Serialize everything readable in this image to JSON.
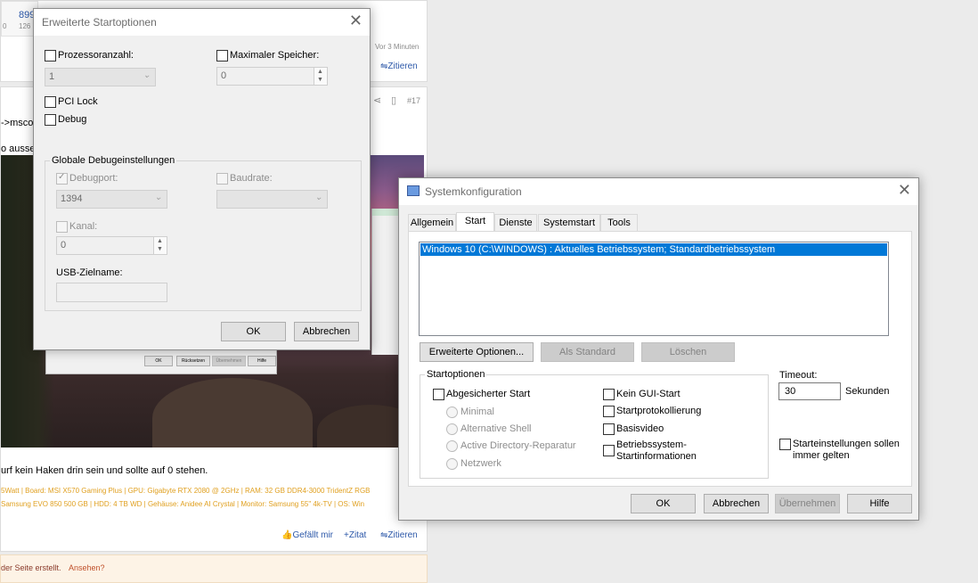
{
  "forum": {
    "post_top": {
      "number": "899",
      "sub": "126",
      "zero": "0",
      "time": "Vor 3 Minuten",
      "quote": "Zitieren"
    },
    "post_mid": {
      "number": "#17",
      "text_mscor": "->mscor",
      "text_aussehen": "o ausseh"
    },
    "post_text": "urf kein Haken drin sein und sollte auf 0 stehen.",
    "sig_line1": "5Watt | Board: MSI X570 Gaming Plus | GPU: Gigabyte RTX 2080 @ 2GHz | RAM: 32 GB DDR4-3000 TridentZ RGB",
    "sig_line2": "Samsung EVO 850 500 GB | HDD: 4 TB WD | Gehäuse: Anidee AI Crystal | Monitor: Samsung 55\" 4k-TV | OS: Win",
    "actions": {
      "like": "Gefällt mir",
      "quote_plus": "Zitat",
      "quote": "Zitieren"
    },
    "notice": "der Seite erstellt.",
    "notice_link": "Ansehen?",
    "thumb_buttons": {
      "ok": "OK",
      "back": "Rücksetzen",
      "apply": "Übernehmen",
      "help": "Hilfe"
    }
  },
  "adv": {
    "title": "Erweiterte Startoptionen",
    "proc_label": "Prozessoranzahl:",
    "proc_value": "1",
    "mem_label": "Maximaler Speicher:",
    "mem_value": "0",
    "pci_label": "PCI Lock",
    "debug_label": "Debug",
    "group_title": "Globale Debugeinstellungen",
    "debugport_label": "Debugport:",
    "debugport_value": "1394",
    "baud_label": "Baudrate:",
    "kanal_label": "Kanal:",
    "kanal_value": "0",
    "usb_label": "USB-Zielname:",
    "ok": "OK",
    "cancel": "Abbrechen"
  },
  "sys": {
    "title": "Systemkonfiguration",
    "tabs": [
      "Allgemein",
      "Start",
      "Dienste",
      "Systemstart",
      "Tools"
    ],
    "boot_entry": "Windows 10 (C:\\WINDOWS) : Aktuelles Betriebssystem; Standardbetriebssystem",
    "btn_advanced": "Erweiterte Optionen...",
    "btn_default": "Als Standard",
    "btn_delete": "Löschen",
    "group_title": "Startoptionen",
    "safe_boot": "Abgesicherter Start",
    "radio_minimal": "Minimal",
    "radio_shell": "Alternative Shell",
    "radio_ad": "Active Directory-Reparatur",
    "radio_net": "Netzwerk",
    "no_gui": "Kein GUI-Start",
    "boot_log": "Startprotokollierung",
    "base_video": "Basisvideo",
    "os_info_1": "Betriebssystem-",
    "os_info_2": "Startinformationen",
    "timeout_label": "Timeout:",
    "timeout_value": "30",
    "seconds": "Sekunden",
    "persist_1": "Starteinstellungen sollen",
    "persist_2": "immer gelten",
    "ok": "OK",
    "cancel": "Abbrechen",
    "apply": "Übernehmen",
    "help": "Hilfe"
  }
}
